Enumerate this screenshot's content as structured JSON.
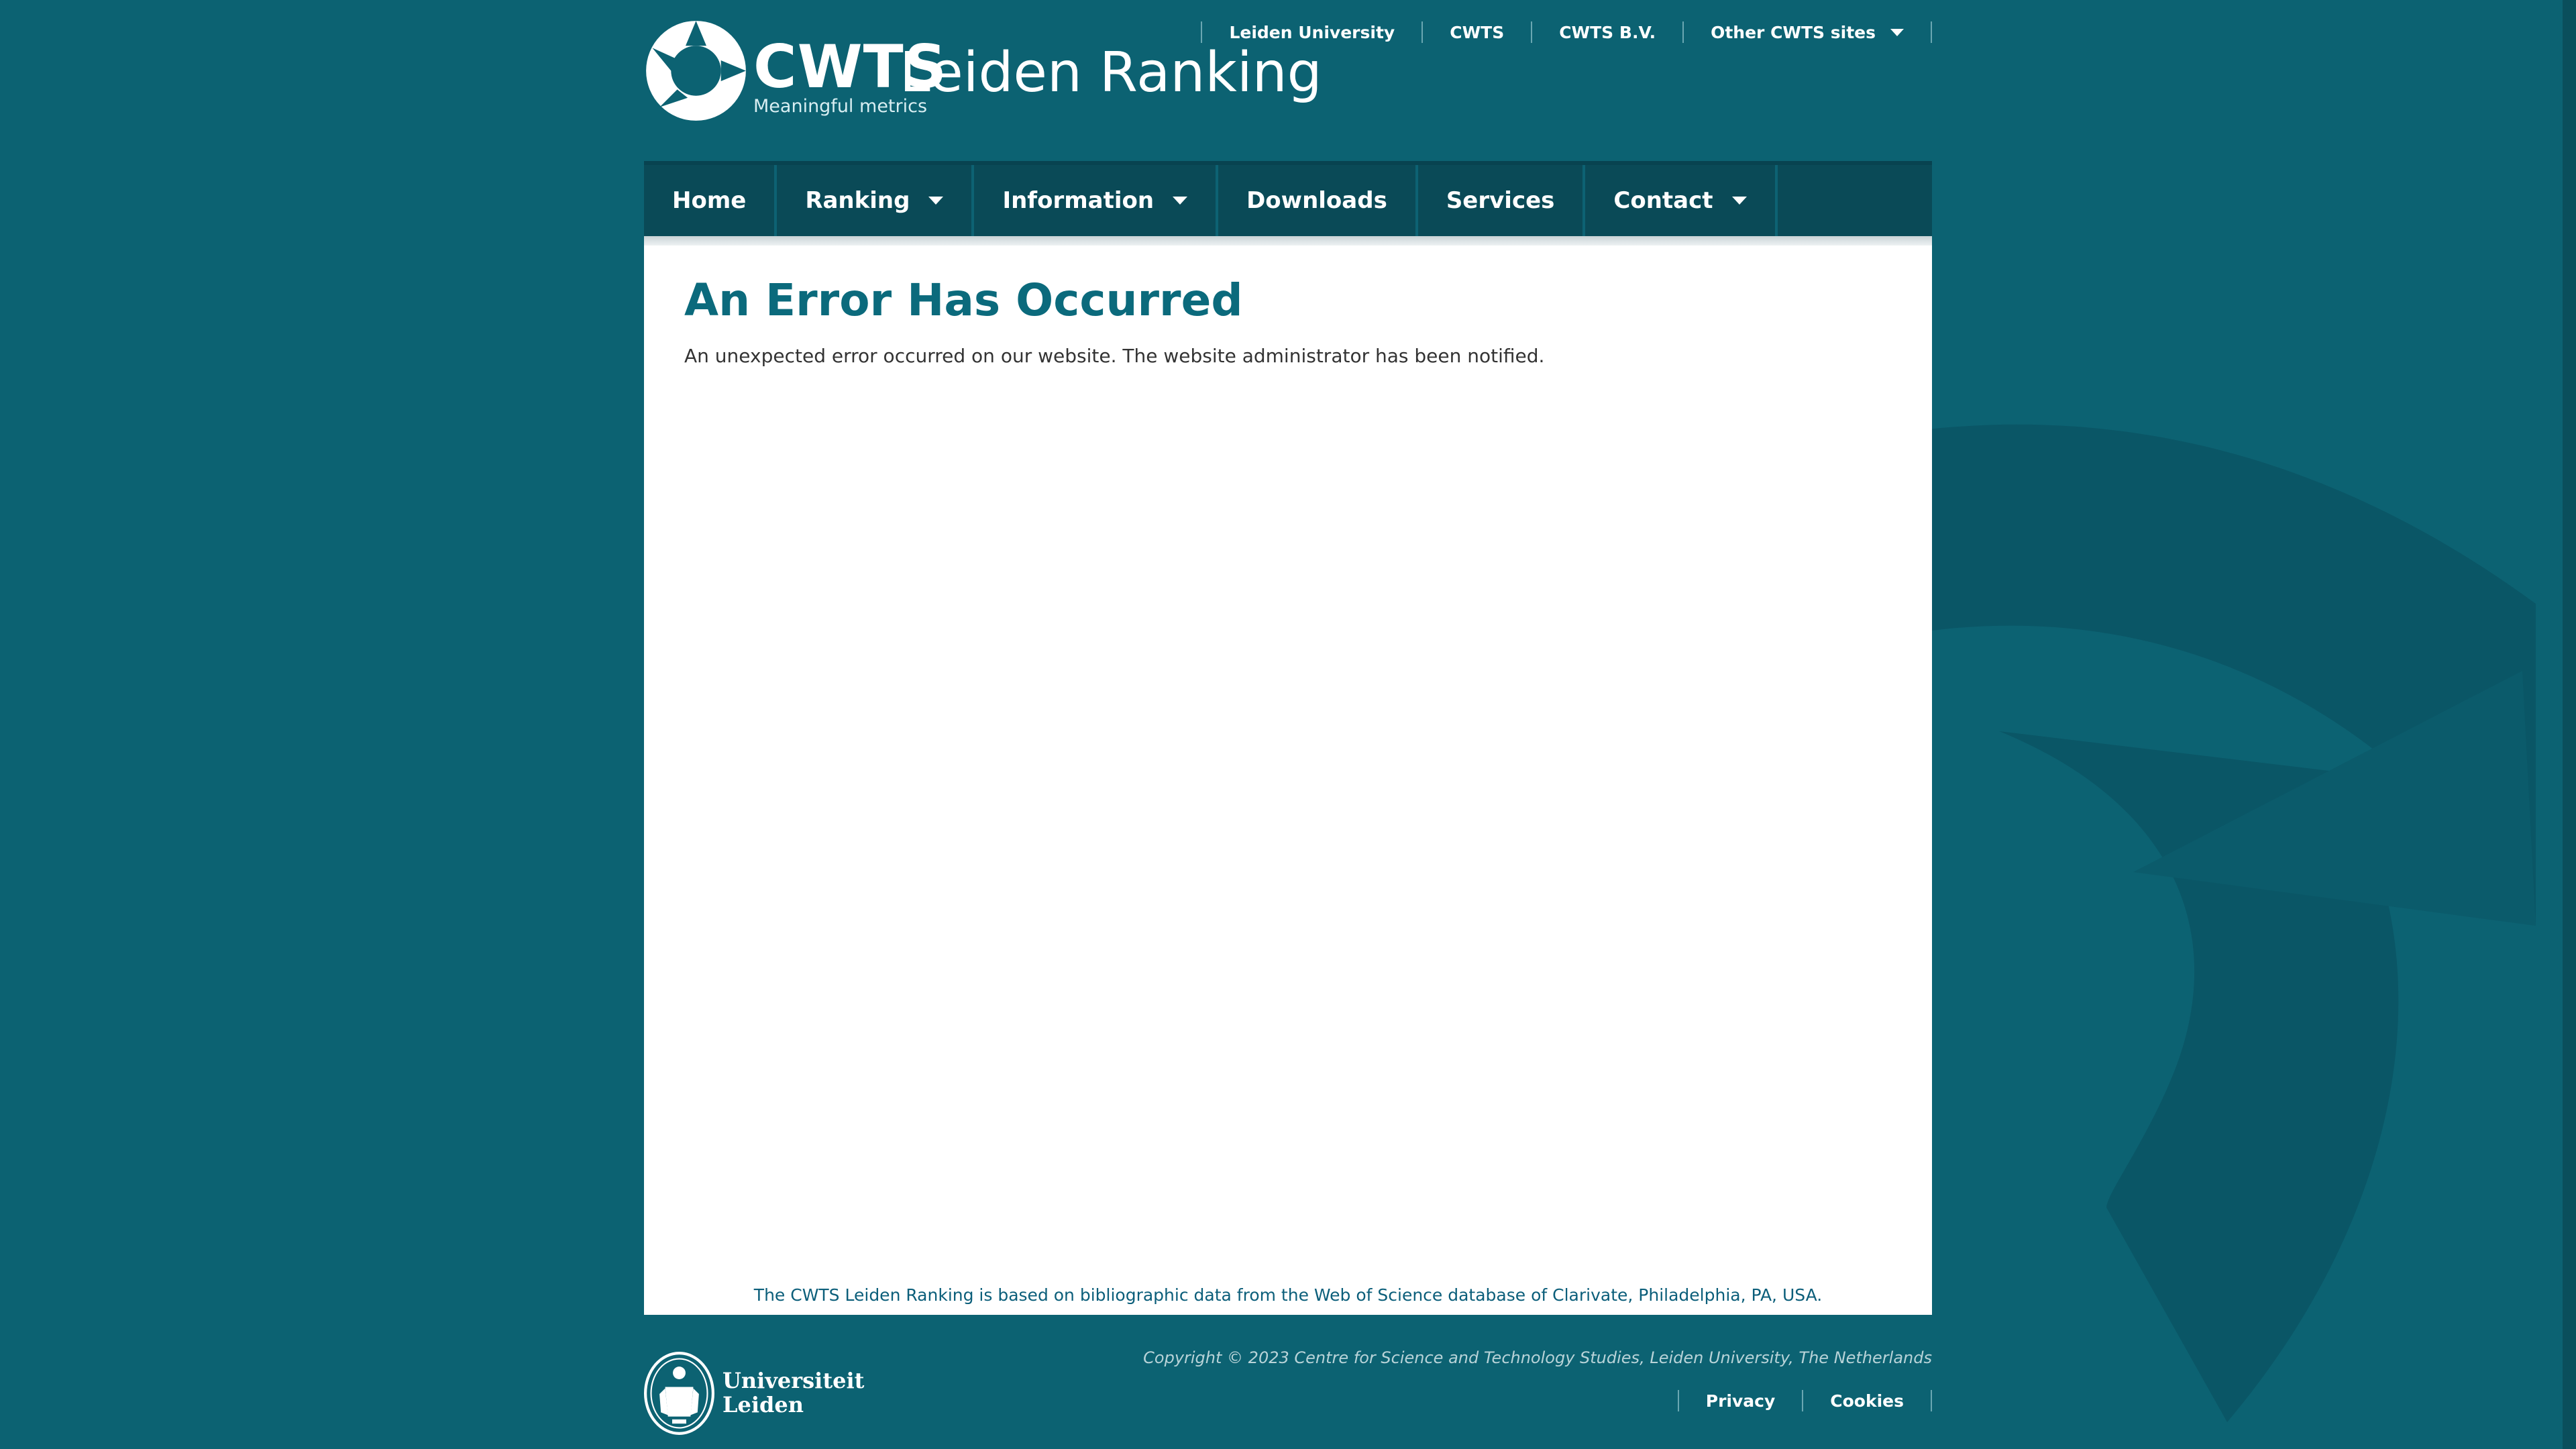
{
  "header": {
    "logo_brand": "CWTS",
    "logo_tagline": "Meaningful metrics",
    "site_title": "Leiden Ranking",
    "top_links": [
      {
        "label": "Leiden University"
      },
      {
        "label": "CWTS"
      },
      {
        "label": "CWTS B.V."
      },
      {
        "label": "Other CWTS sites",
        "dropdown": true
      }
    ]
  },
  "nav": {
    "items": [
      {
        "label": "Home"
      },
      {
        "label": "Ranking",
        "dropdown": true
      },
      {
        "label": "Information",
        "dropdown": true
      },
      {
        "label": "Downloads"
      },
      {
        "label": "Services"
      },
      {
        "label": "Contact",
        "dropdown": true
      }
    ]
  },
  "main": {
    "title": "An Error Has Occurred",
    "message": "An unexpected error occurred on our website. The website administrator has been notified.",
    "data_note": "The CWTS Leiden Ranking is based on bibliographic data from the Web of Science database of Clarivate, Philadelphia, PA, USA."
  },
  "footer": {
    "university_line1": "Universiteit",
    "university_line2": "Leiden",
    "copyright": "Copyright © 2023 Centre for Science and Technology Studies, Leiden University, The Netherlands",
    "links": [
      {
        "label": "Privacy"
      },
      {
        "label": "Cookies"
      }
    ]
  },
  "icons": {
    "logo_mark": "cwts-circle-logo-icon",
    "dropdown": "caret-down-icon",
    "university_seal": "leiden-seal-icon"
  },
  "colors": {
    "page_background": "#0c6272",
    "nav_background": "#0a4a57",
    "content_background": "#ffffff",
    "heading": "#0b6a7c",
    "link": "#0b5e7a"
  }
}
